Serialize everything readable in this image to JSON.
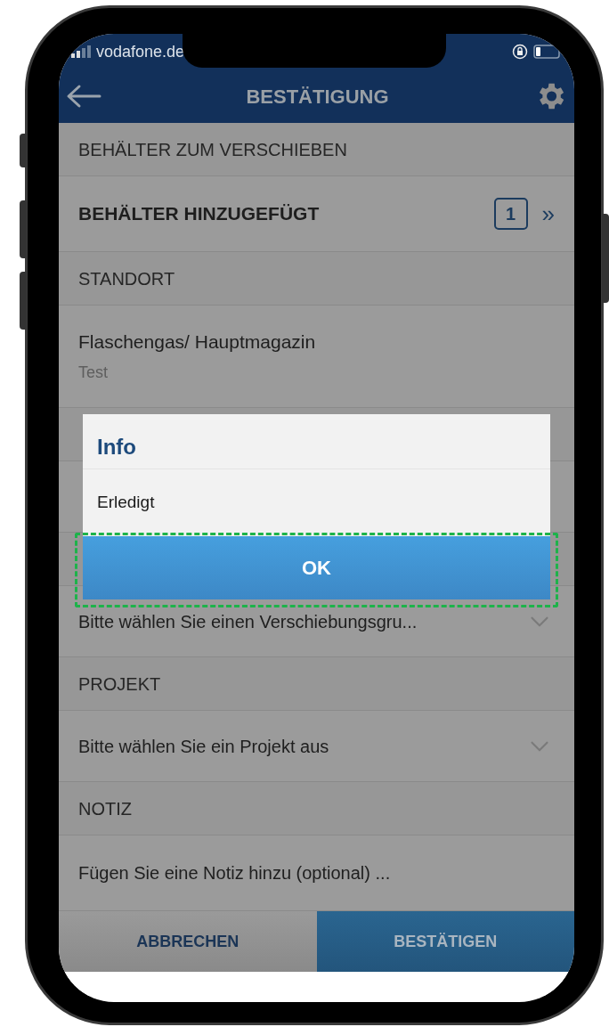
{
  "status_bar": {
    "carrier": "vodafone.de"
  },
  "header": {
    "title": "BESTÄTIGUNG"
  },
  "rows": [
    {
      "kind": "section",
      "label": "BEHÄLTER ZUM VERSCHIEBEN"
    },
    {
      "kind": "link",
      "label": "BEHÄLTER HINZUGEFÜGT",
      "count": "1",
      "chevron": "»"
    },
    {
      "kind": "section",
      "label": "STANDORT"
    },
    {
      "kind": "value",
      "label": "Flaschengas/ Hauptmagazin",
      "sublabel": "Test"
    },
    {
      "kind": "covered_section"
    },
    {
      "kind": "covered_select"
    },
    {
      "kind": "covered_section"
    },
    {
      "kind": "select",
      "text": "Bitte wählen Sie einen Verschiebungsgru..."
    },
    {
      "kind": "section",
      "label": "PROJEKT"
    },
    {
      "kind": "select",
      "text": "Bitte wählen Sie ein Projekt aus"
    },
    {
      "kind": "section",
      "label": "NOTIZ"
    },
    {
      "kind": "field",
      "text": "Fügen Sie eine Notiz hinzu (optional) ..."
    }
  ],
  "dialog": {
    "title": "Info",
    "message": "Erledigt",
    "button": "OK",
    "highlighted": true
  },
  "buttons": [
    {
      "label": "ABBRECHEN",
      "kind": "secondary"
    },
    {
      "label": "BESTÄTIGEN",
      "kind": "primary"
    }
  ]
}
